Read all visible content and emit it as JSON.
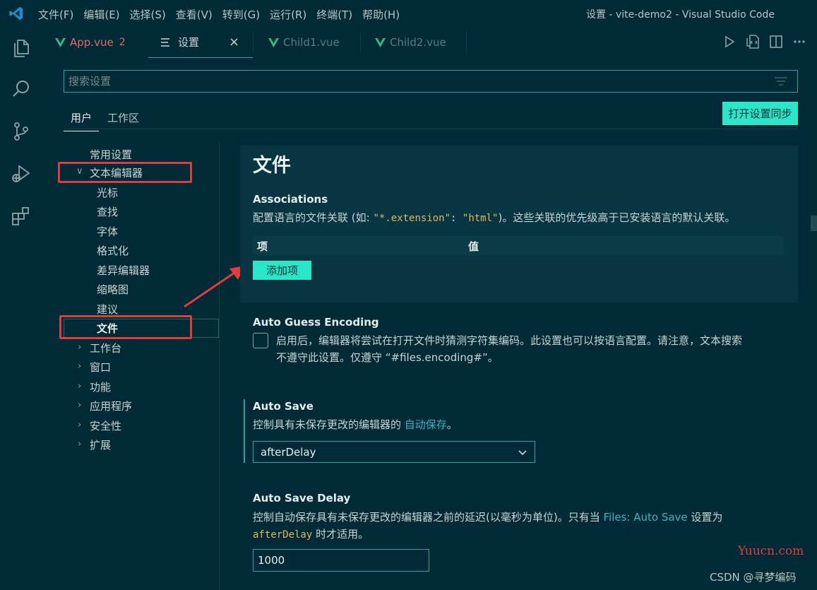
{
  "window": {
    "title": "设置 - vite-demo2 - Visual Studio Code",
    "menu": [
      "文件(F)",
      "编辑(E)",
      "选择(S)",
      "查看(V)",
      "转到(G)",
      "运行(R)",
      "终端(T)",
      "帮助(H)"
    ]
  },
  "tabs": [
    {
      "label": "App.vue",
      "badge": "2",
      "state": "modified-error"
    },
    {
      "label": "设置",
      "state": "active"
    },
    {
      "label": "Child1.vue",
      "state": "inactive"
    },
    {
      "label": "Child2.vue",
      "state": "inactive"
    }
  ],
  "settings": {
    "search_placeholder": "搜索设置",
    "scopes": [
      "用户",
      "工作区"
    ],
    "sync_button": "打开设置同步"
  },
  "toc": {
    "items": [
      {
        "label": "常用设置",
        "level": 0
      },
      {
        "label": "文本编辑器",
        "level": 0,
        "expanded": true
      },
      {
        "label": "光标",
        "level": 1
      },
      {
        "label": "查找",
        "level": 1
      },
      {
        "label": "字体",
        "level": 1
      },
      {
        "label": "格式化",
        "level": 1
      },
      {
        "label": "差异编辑器",
        "level": 1
      },
      {
        "label": "缩略图",
        "level": 1
      },
      {
        "label": "建议",
        "level": 1
      },
      {
        "label": "文件",
        "level": 1,
        "selected": true
      },
      {
        "label": "工作台",
        "level": 0,
        "collapsed": true
      },
      {
        "label": "窗口",
        "level": 0,
        "collapsed": true
      },
      {
        "label": "功能",
        "level": 0,
        "collapsed": true
      },
      {
        "label": "应用程序",
        "level": 0,
        "collapsed": true
      },
      {
        "label": "安全性",
        "level": 0,
        "collapsed": true
      },
      {
        "label": "扩展",
        "level": 0,
        "collapsed": true
      }
    ]
  },
  "content": {
    "section_title": "文件",
    "associations": {
      "label": "Associations",
      "desc_prefix": "配置语言的文件关联 (如: ",
      "code_key": "\"*.extension\"",
      "code_sep": ": ",
      "code_val": "\"html\"",
      "desc_suffix": ")。这些关联的优先级高于已安装语言的默认关联。",
      "col_item": "项",
      "col_value": "值",
      "add_button": "添加项"
    },
    "auto_guess": {
      "label": "Auto Guess Encoding",
      "desc_line1": "启用后，编辑器将尝试在打开文件时猜测字符集编码。此设置也可以按语言配置。请注意，文本搜索",
      "desc_line2": "不遵守此设置。仅遵守 “#files.encoding#”。",
      "checked": false
    },
    "auto_save": {
      "label": "Auto Save",
      "desc_prefix": "控制具有未保存更改的编辑器的 ",
      "desc_link": "自动保存",
      "desc_suffix": "。",
      "value": "afterDelay"
    },
    "auto_save_delay": {
      "label": "Auto Save Delay",
      "desc_prefix": "控制自动保存具有未保存更改的编辑器之前的延迟(以毫秒为单位)。只有当 ",
      "desc_link": "Files: Auto Save",
      "desc_mid": " 设置为",
      "desc_code": "afterDelay",
      "desc_suffix": " 时才适用。",
      "value": "1000"
    }
  },
  "watermarks": {
    "site": "Yuucn.com",
    "author": "CSDN @寻梦编码"
  },
  "colors": {
    "background": "#002b36",
    "accent": "#2ae6c9",
    "annotation_red": "#e23b3b",
    "modified_tab": "#e26a5f"
  }
}
